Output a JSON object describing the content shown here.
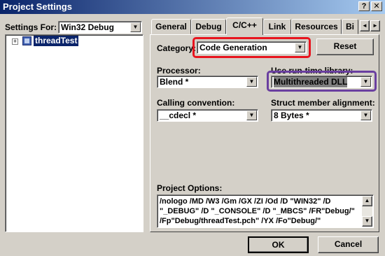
{
  "window": {
    "title": "Project Settings",
    "help_glyph": "?",
    "close_glyph": "✕"
  },
  "settings_for": {
    "label": "Settings For:",
    "value": "Win32 Debug"
  },
  "tree": {
    "expander": "+",
    "item": "threadTest"
  },
  "tabs": [
    {
      "label": "General"
    },
    {
      "label": "Debug"
    },
    {
      "label": "C/C++"
    },
    {
      "label": "Link"
    },
    {
      "label": "Resources"
    },
    {
      "label": "Bi"
    }
  ],
  "tab_scroll": {
    "left": "◄",
    "right": "►"
  },
  "category": {
    "label": "Category:",
    "value": "Code Generation"
  },
  "reset_button": "Reset",
  "processor": {
    "label": "Processor:",
    "value": "Blend *"
  },
  "runtime_library": {
    "label": "Use run-time library:",
    "value": "Multithreaded DLL"
  },
  "calling_convention": {
    "label": "Calling convention:",
    "value": "__cdecl *"
  },
  "struct_alignment": {
    "label": "Struct member alignment:",
    "value": "8 Bytes *"
  },
  "project_options": {
    "label": "Project Options:",
    "lines": [
      "/nologo /MD /W3 /Gm /GX /ZI /Od /D \"WIN32\" /D",
      "\"_DEBUG\" /D \"_CONSOLE\" /D \"_MBCS\" /FR\"Debug/\"",
      "/Fp\"Debug/threadTest.pch\" /YX /Fo\"Debug/\""
    ]
  },
  "ok_button": "OK",
  "cancel_button": "Cancel",
  "highlight_colors": {
    "category": "#e8141e",
    "runtime": "#6a3fa0"
  }
}
